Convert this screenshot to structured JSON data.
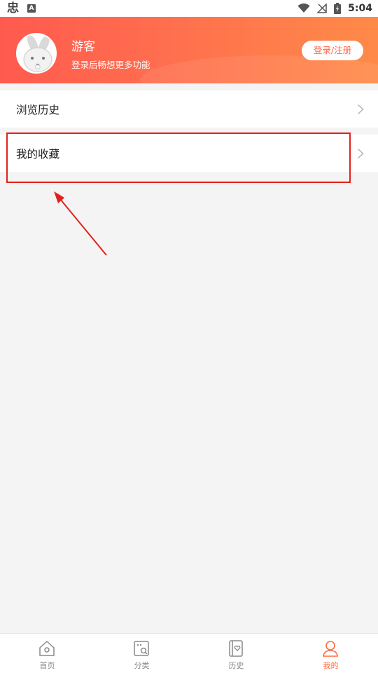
{
  "status_bar": {
    "app_glyph": "忠",
    "notif_glyph": "A",
    "time": "5:04"
  },
  "header": {
    "username": "游客",
    "subtitle": "登录后畅想更多功能",
    "login_button": "登录/注册"
  },
  "menu": {
    "items": [
      {
        "label": "浏览历史"
      },
      {
        "label": "我的收藏"
      }
    ]
  },
  "bottom_nav": {
    "items": [
      {
        "label": "首页",
        "icon": "home-icon"
      },
      {
        "label": "分类",
        "icon": "category-icon"
      },
      {
        "label": "历史",
        "icon": "history-icon"
      },
      {
        "label": "我的",
        "icon": "profile-icon",
        "active": true
      }
    ]
  },
  "colors": {
    "accent": "#ff6a3c",
    "annotation": "#e3211b"
  }
}
